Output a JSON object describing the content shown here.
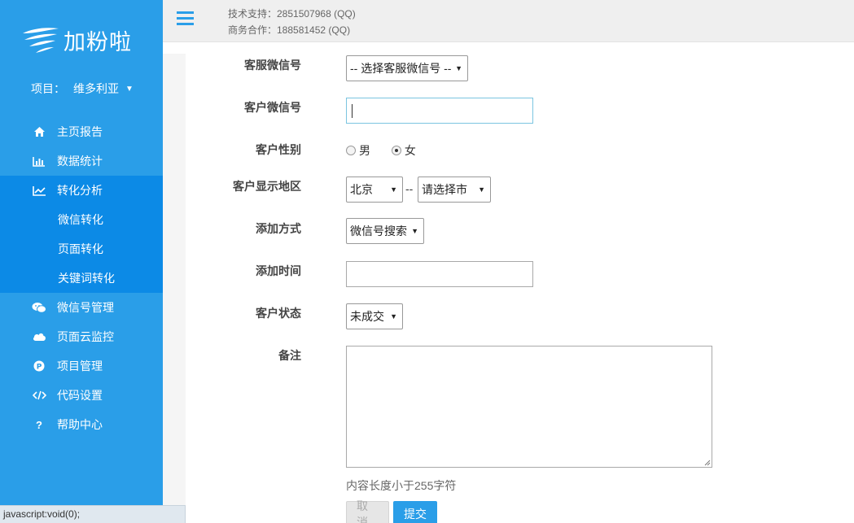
{
  "brand": {
    "name": "加粉啦"
  },
  "project": {
    "label": "项目：",
    "value": "维多利亚"
  },
  "sidebar": {
    "items": [
      {
        "label": "主页报告",
        "icon": "home-icon"
      },
      {
        "label": "数据统计",
        "icon": "bar-chart-icon"
      },
      {
        "label": "转化分析",
        "icon": "line-chart-icon"
      },
      {
        "label": "微信转化"
      },
      {
        "label": "页面转化"
      },
      {
        "label": "关键词转化"
      },
      {
        "label": "微信号管理",
        "icon": "wechat-icon"
      },
      {
        "label": "页面云监控",
        "icon": "cloud-icon"
      },
      {
        "label": "项目管理",
        "icon": "p-circle-icon"
      },
      {
        "label": "代码设置",
        "icon": "code-icon"
      },
      {
        "label": "帮助中心",
        "icon": "question-icon"
      }
    ]
  },
  "header": {
    "support": "技术支持：2851507968 (QQ)",
    "business": "商务合作：188581452 (QQ)"
  },
  "form": {
    "service_wechat": {
      "label": "客服微信号",
      "value": "-- 选择客服微信号 --"
    },
    "customer_wechat": {
      "label": "客户微信号",
      "value": ""
    },
    "gender": {
      "label": "客户性别",
      "options": [
        "男",
        "女"
      ],
      "selected": "女"
    },
    "region": {
      "label": "客户显示地区",
      "province": "北京",
      "separator": "--",
      "city": "请选择市"
    },
    "add_method": {
      "label": "添加方式",
      "value": "微信号搜索"
    },
    "add_time": {
      "label": "添加时间",
      "value": ""
    },
    "status": {
      "label": "客户状态",
      "value": "未成交"
    },
    "remark": {
      "label": "备注",
      "value": "",
      "hint": "内容长度小于255字符"
    },
    "cancel_label": "取消",
    "submit_label": "提交"
  },
  "statusbar": {
    "text": "javascript:void(0);"
  },
  "colors": {
    "accent": "#2a9ee8",
    "active": "#0c8ae6"
  }
}
